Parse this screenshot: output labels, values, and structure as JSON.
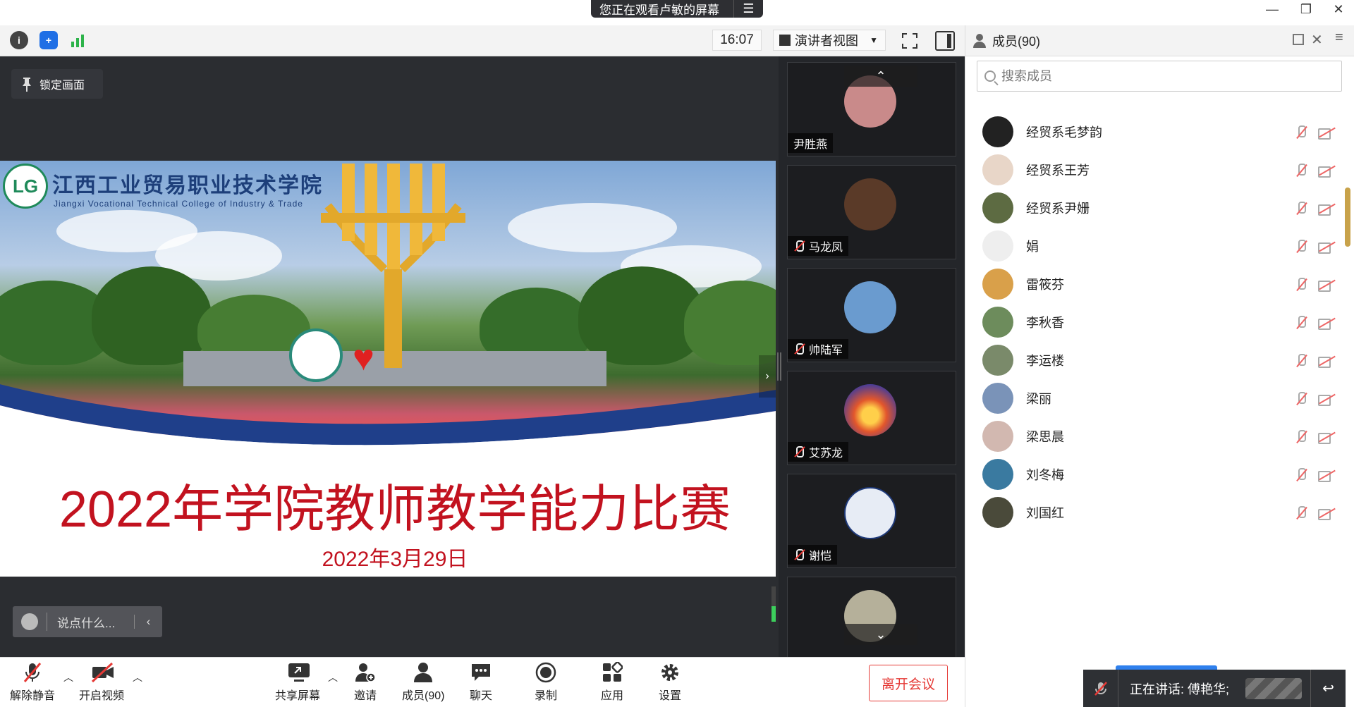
{
  "share_banner": {
    "text": "您正在观看卢敏的屏幕",
    "menu_glyph": "☰"
  },
  "window_controls": {
    "minimize": "—",
    "maximize": "❐",
    "close": "✕"
  },
  "toolbar": {
    "clock": "16:07",
    "view_mode": "演讲者视图",
    "info_glyph": "i",
    "shield_glyph": "+"
  },
  "stage": {
    "lock_label": "锁定画面",
    "chat_placeholder": "说点什么...",
    "next_glyph": "›"
  },
  "slide": {
    "college_cn": "江西工业贸易职业技术学院",
    "college_en": "Jiangxi Vocational Technical College of Industry & Trade",
    "title": "2022年学院教师教学能力比赛",
    "date": "2022年3月29日"
  },
  "thumbnails": [
    {
      "name": "尹胜燕",
      "muted": false,
      "color": "#c98a8a"
    },
    {
      "name": "马龙凤",
      "muted": true,
      "color": "#5a3a28"
    },
    {
      "name": "帅陆军",
      "muted": true,
      "color": "#6a9bcf"
    },
    {
      "name": "艾苏龙",
      "muted": true,
      "color": "#e2562c"
    },
    {
      "name": "谢恺",
      "muted": true,
      "color": "#e7ecf5"
    },
    {
      "name": "",
      "muted": true,
      "color": "#b5b09a"
    }
  ],
  "bottom_bar": {
    "unmute": "解除静音",
    "start_video": "开启视频",
    "share_screen": "共享屏幕",
    "invite": "邀请",
    "members": "成员(90)",
    "chat": "聊天",
    "record": "录制",
    "apps": "应用",
    "settings": "设置",
    "leave": "离开会议"
  },
  "members_panel": {
    "title": "成员(90)",
    "search_placeholder": "搜索成员",
    "rows": [
      {
        "name": "经贸系毛梦韵",
        "color": "#222222"
      },
      {
        "name": "经贸系王芳",
        "color": "#e8d6c8"
      },
      {
        "name": "经贸系尹姗",
        "color": "#5d6b42"
      },
      {
        "name": "娟",
        "color": "#eeeeee"
      },
      {
        "name": "雷筱芬",
        "color": "#d9a04a"
      },
      {
        "name": "李秋香",
        "color": "#6d8c5c"
      },
      {
        "name": "李运楼",
        "color": "#7a8a6a"
      },
      {
        "name": "梁丽",
        "color": "#7a93b8"
      },
      {
        "name": "梁思晨",
        "color": "#d2b8b0"
      },
      {
        "name": "刘冬梅",
        "color": "#3a7aa0"
      },
      {
        "name": "刘国红",
        "color": "#4a4a3a"
      }
    ]
  },
  "speaking": {
    "text": "正在讲话: 傅艳华;"
  }
}
